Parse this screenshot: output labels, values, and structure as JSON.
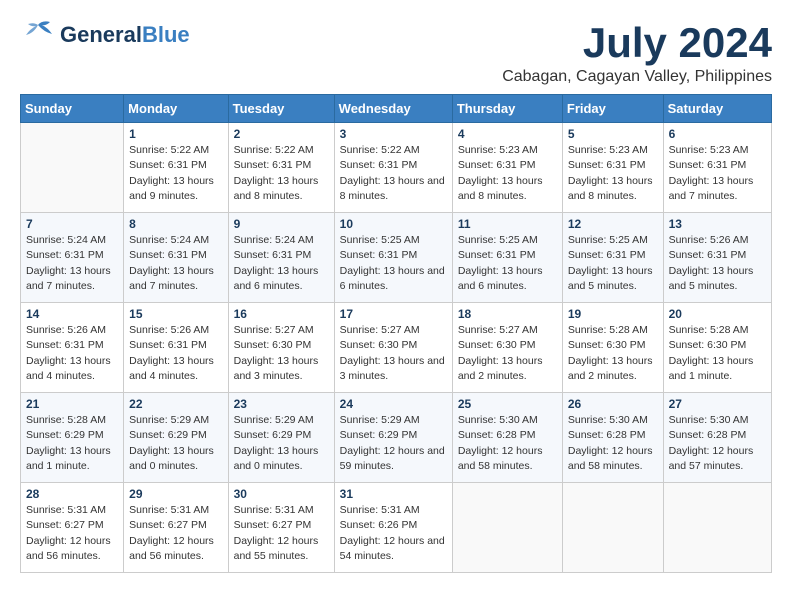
{
  "header": {
    "logo_general": "General",
    "logo_blue": "Blue",
    "month_title": "July 2024",
    "location": "Cabagan, Cagayan Valley, Philippines"
  },
  "calendar": {
    "days_of_week": [
      "Sunday",
      "Monday",
      "Tuesday",
      "Wednesday",
      "Thursday",
      "Friday",
      "Saturday"
    ],
    "weeks": [
      [
        {
          "day": "",
          "sunrise": "",
          "sunset": "",
          "daylight": ""
        },
        {
          "day": "1",
          "sunrise": "Sunrise: 5:22 AM",
          "sunset": "Sunset: 6:31 PM",
          "daylight": "Daylight: 13 hours and 9 minutes."
        },
        {
          "day": "2",
          "sunrise": "Sunrise: 5:22 AM",
          "sunset": "Sunset: 6:31 PM",
          "daylight": "Daylight: 13 hours and 8 minutes."
        },
        {
          "day": "3",
          "sunrise": "Sunrise: 5:22 AM",
          "sunset": "Sunset: 6:31 PM",
          "daylight": "Daylight: 13 hours and 8 minutes."
        },
        {
          "day": "4",
          "sunrise": "Sunrise: 5:23 AM",
          "sunset": "Sunset: 6:31 PM",
          "daylight": "Daylight: 13 hours and 8 minutes."
        },
        {
          "day": "5",
          "sunrise": "Sunrise: 5:23 AM",
          "sunset": "Sunset: 6:31 PM",
          "daylight": "Daylight: 13 hours and 8 minutes."
        },
        {
          "day": "6",
          "sunrise": "Sunrise: 5:23 AM",
          "sunset": "Sunset: 6:31 PM",
          "daylight": "Daylight: 13 hours and 7 minutes."
        }
      ],
      [
        {
          "day": "7",
          "sunrise": "Sunrise: 5:24 AM",
          "sunset": "Sunset: 6:31 PM",
          "daylight": "Daylight: 13 hours and 7 minutes."
        },
        {
          "day": "8",
          "sunrise": "Sunrise: 5:24 AM",
          "sunset": "Sunset: 6:31 PM",
          "daylight": "Daylight: 13 hours and 7 minutes."
        },
        {
          "day": "9",
          "sunrise": "Sunrise: 5:24 AM",
          "sunset": "Sunset: 6:31 PM",
          "daylight": "Daylight: 13 hours and 6 minutes."
        },
        {
          "day": "10",
          "sunrise": "Sunrise: 5:25 AM",
          "sunset": "Sunset: 6:31 PM",
          "daylight": "Daylight: 13 hours and 6 minutes."
        },
        {
          "day": "11",
          "sunrise": "Sunrise: 5:25 AM",
          "sunset": "Sunset: 6:31 PM",
          "daylight": "Daylight: 13 hours and 6 minutes."
        },
        {
          "day": "12",
          "sunrise": "Sunrise: 5:25 AM",
          "sunset": "Sunset: 6:31 PM",
          "daylight": "Daylight: 13 hours and 5 minutes."
        },
        {
          "day": "13",
          "sunrise": "Sunrise: 5:26 AM",
          "sunset": "Sunset: 6:31 PM",
          "daylight": "Daylight: 13 hours and 5 minutes."
        }
      ],
      [
        {
          "day": "14",
          "sunrise": "Sunrise: 5:26 AM",
          "sunset": "Sunset: 6:31 PM",
          "daylight": "Daylight: 13 hours and 4 minutes."
        },
        {
          "day": "15",
          "sunrise": "Sunrise: 5:26 AM",
          "sunset": "Sunset: 6:31 PM",
          "daylight": "Daylight: 13 hours and 4 minutes."
        },
        {
          "day": "16",
          "sunrise": "Sunrise: 5:27 AM",
          "sunset": "Sunset: 6:30 PM",
          "daylight": "Daylight: 13 hours and 3 minutes."
        },
        {
          "day": "17",
          "sunrise": "Sunrise: 5:27 AM",
          "sunset": "Sunset: 6:30 PM",
          "daylight": "Daylight: 13 hours and 3 minutes."
        },
        {
          "day": "18",
          "sunrise": "Sunrise: 5:27 AM",
          "sunset": "Sunset: 6:30 PM",
          "daylight": "Daylight: 13 hours and 2 minutes."
        },
        {
          "day": "19",
          "sunrise": "Sunrise: 5:28 AM",
          "sunset": "Sunset: 6:30 PM",
          "daylight": "Daylight: 13 hours and 2 minutes."
        },
        {
          "day": "20",
          "sunrise": "Sunrise: 5:28 AM",
          "sunset": "Sunset: 6:30 PM",
          "daylight": "Daylight: 13 hours and 1 minute."
        }
      ],
      [
        {
          "day": "21",
          "sunrise": "Sunrise: 5:28 AM",
          "sunset": "Sunset: 6:29 PM",
          "daylight": "Daylight: 13 hours and 1 minute."
        },
        {
          "day": "22",
          "sunrise": "Sunrise: 5:29 AM",
          "sunset": "Sunset: 6:29 PM",
          "daylight": "Daylight: 13 hours and 0 minutes."
        },
        {
          "day": "23",
          "sunrise": "Sunrise: 5:29 AM",
          "sunset": "Sunset: 6:29 PM",
          "daylight": "Daylight: 13 hours and 0 minutes."
        },
        {
          "day": "24",
          "sunrise": "Sunrise: 5:29 AM",
          "sunset": "Sunset: 6:29 PM",
          "daylight": "Daylight: 12 hours and 59 minutes."
        },
        {
          "day": "25",
          "sunrise": "Sunrise: 5:30 AM",
          "sunset": "Sunset: 6:28 PM",
          "daylight": "Daylight: 12 hours and 58 minutes."
        },
        {
          "day": "26",
          "sunrise": "Sunrise: 5:30 AM",
          "sunset": "Sunset: 6:28 PM",
          "daylight": "Daylight: 12 hours and 58 minutes."
        },
        {
          "day": "27",
          "sunrise": "Sunrise: 5:30 AM",
          "sunset": "Sunset: 6:28 PM",
          "daylight": "Daylight: 12 hours and 57 minutes."
        }
      ],
      [
        {
          "day": "28",
          "sunrise": "Sunrise: 5:31 AM",
          "sunset": "Sunset: 6:27 PM",
          "daylight": "Daylight: 12 hours and 56 minutes."
        },
        {
          "day": "29",
          "sunrise": "Sunrise: 5:31 AM",
          "sunset": "Sunset: 6:27 PM",
          "daylight": "Daylight: 12 hours and 56 minutes."
        },
        {
          "day": "30",
          "sunrise": "Sunrise: 5:31 AM",
          "sunset": "Sunset: 6:27 PM",
          "daylight": "Daylight: 12 hours and 55 minutes."
        },
        {
          "day": "31",
          "sunrise": "Sunrise: 5:31 AM",
          "sunset": "Sunset: 6:26 PM",
          "daylight": "Daylight: 12 hours and 54 minutes."
        },
        {
          "day": "",
          "sunrise": "",
          "sunset": "",
          "daylight": ""
        },
        {
          "day": "",
          "sunrise": "",
          "sunset": "",
          "daylight": ""
        },
        {
          "day": "",
          "sunrise": "",
          "sunset": "",
          "daylight": ""
        }
      ]
    ]
  }
}
